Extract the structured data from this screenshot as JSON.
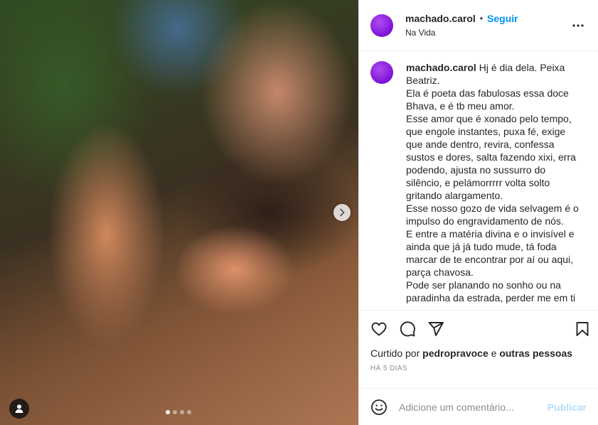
{
  "post": {
    "username": "machado.carol",
    "separator": "•",
    "follow_label": "Seguir",
    "location": "Na Vida",
    "caption_username": "machado.carol",
    "caption_text": " Hj é dia dela. Peixa Beatriz.\nEla é poeta das fabulosas essa doce Bhava, e é tb meu amor.\nEsse amor que é xonado pelo tempo, que engole instantes, puxa fé, exige que ande dentro, revira, confessa sustos e dores, salta fazendo xixi, erra podendo, ajusta no sussurro do silêncio, e pelámorrrrr volta solto gritando alargamento.\nEsse nosso gozo de vida selvagem é o impulso do engravidamento de nós.\nE entre a matéria divina e o invisível e ainda que já já tudo mude, tá foda marcar de te encontrar por aí ou aqui, parça chavosa.\nPode ser planando no sonho ou na paradinha da estrada, perder me em ti",
    "liked_prefix": "Curtido por ",
    "liked_user": "pedropravoce",
    "liked_mid": " e ",
    "liked_others": "outras pessoas",
    "date": "HÁ 5 DIAS"
  },
  "carousel": {
    "slides": 4,
    "active_index": 0
  },
  "comment": {
    "placeholder": "Adicione um comentário...",
    "publish_label": "Publicar"
  },
  "icons": {
    "more": "more-horizontal-icon",
    "like": "heart-icon",
    "comment": "comment-icon",
    "share": "share-icon",
    "save": "bookmark-icon",
    "emoji": "emoji-icon",
    "next": "chevron-right-icon",
    "tag": "user-tag-icon"
  },
  "colors": {
    "accent": "#0095f6",
    "publish_disabled": "#b2dffc",
    "muted": "#8e8e8e",
    "text": "#262626",
    "avatar": "#7d12d6"
  }
}
